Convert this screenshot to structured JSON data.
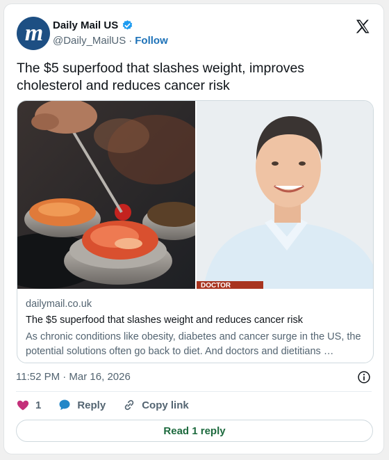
{
  "account": {
    "display_name": "Daily Mail US",
    "handle": "@Daily_MailUS",
    "separator": "·",
    "follow_label": "Follow",
    "avatar_letter": "m"
  },
  "tweet": {
    "text": "The $5 superfood that slashes weight, improves cholesterol and reduces cancer risk"
  },
  "link_card": {
    "image_caption": "DOCTOR",
    "domain": "dailymail.co.uk",
    "title": "The $5 superfood that slashes weight and reduces cancer risk",
    "description": "As chronic conditions like obesity, diabetes and cancer surge in the US, the potential solutions often go back to diet. And doctors and dietitians …"
  },
  "meta": {
    "timestamp": "11:52 PM · Mar 16, 2026"
  },
  "actions": {
    "like_count": "1",
    "reply_label": "Reply",
    "copy_link_label": "Copy link",
    "read_replies_label": "Read 1 reply"
  },
  "colors": {
    "verified": "#1d9bf0",
    "like": "#c4307a",
    "reply_icon": "#2287c8",
    "read_reply_text": "#1d6a3e"
  }
}
